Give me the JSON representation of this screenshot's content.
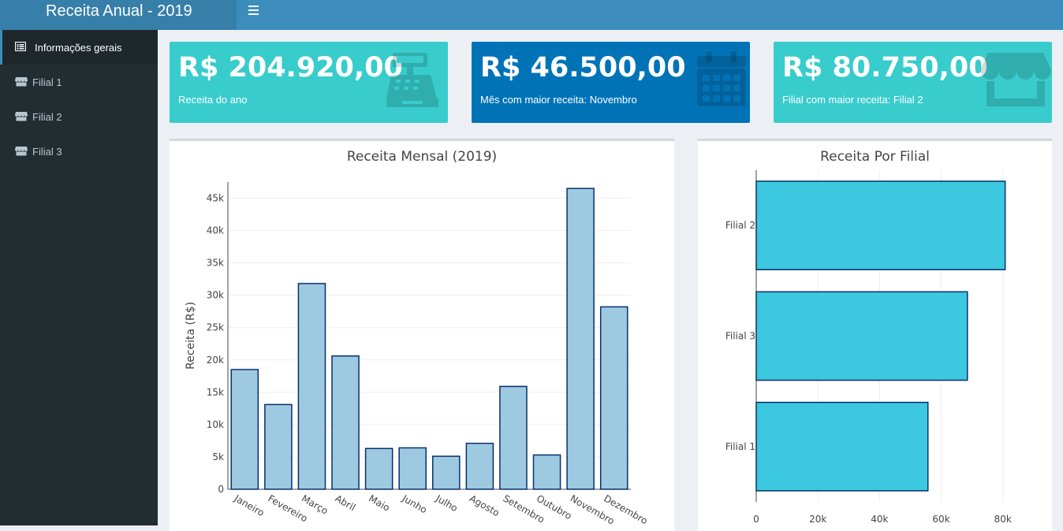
{
  "header": {
    "title": "Receita Anual - 2019",
    "menu_icon": "hamburger-icon"
  },
  "sidebar": {
    "items": [
      {
        "label": "Informações gerais",
        "icon": "list-icon",
        "active": true
      },
      {
        "label": "Filial 1",
        "icon": "store-icon"
      },
      {
        "label": "Filial 2",
        "icon": "store-icon"
      },
      {
        "label": "Filial 3",
        "icon": "store-icon"
      }
    ]
  },
  "value_boxes": [
    {
      "value": "R$ 204.920,00",
      "subtitle": "Receita do ano",
      "icon": "cash-register-icon",
      "color": "#39cccc"
    },
    {
      "value": "R$ 46.500,00",
      "subtitle": "Mês com maior receita: Novembro",
      "icon": "calendar-icon",
      "color": "#0073b7"
    },
    {
      "value": "R$ 80.750,00",
      "subtitle": "Filial com maior receita: Filial 2",
      "icon": "store-icon",
      "color": "#39cccc"
    }
  ],
  "chart_data": [
    {
      "type": "bar",
      "title": "Receita Mensal (2019)",
      "xlabel": "",
      "ylabel": "Receita (R$)",
      "categories": [
        "Janeiro",
        "Fevereiro",
        "Março",
        "Abril",
        "Maio",
        "Junho",
        "Julho",
        "Agosto",
        "Setembro",
        "Outubro",
        "Novembro",
        "Dezembro"
      ],
      "values": [
        18500,
        13100,
        31800,
        20600,
        6300,
        6400,
        5100,
        7100,
        15900,
        5300,
        46500,
        28200
      ],
      "ylim": [
        0,
        47500
      ],
      "yticks": [
        0,
        5000,
        10000,
        15000,
        20000,
        25000,
        30000,
        35000,
        40000,
        45000
      ],
      "ytick_labels": [
        "0",
        "5k",
        "10k",
        "15k",
        "20k",
        "25k",
        "30k",
        "35k",
        "40k",
        "45k"
      ],
      "grid": true,
      "bar_color": "#9ecae1",
      "bar_border": "#08306b"
    },
    {
      "type": "bar",
      "orientation": "horizontal",
      "title": "Receita Por Filial",
      "categories": [
        "Filial 2",
        "Filial 3",
        "Filial 1"
      ],
      "values": [
        80750,
        68500,
        55700
      ],
      "xlim": [
        0,
        88000
      ],
      "xticks": [
        0,
        20000,
        40000,
        60000,
        80000
      ],
      "xtick_labels": [
        "0",
        "20k",
        "40k",
        "60k",
        "80k"
      ],
      "grid": true,
      "bar_color": "#3cc8df",
      "bar_border": "#08306b"
    }
  ]
}
